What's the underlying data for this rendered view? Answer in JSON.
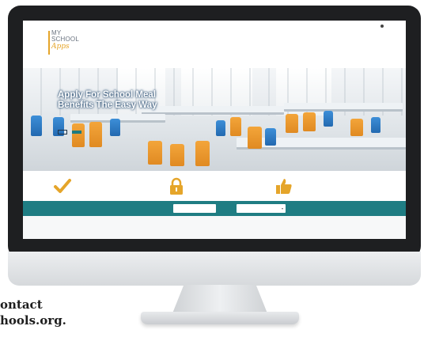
{
  "top_nav": {
    "items": [
      "",
      "",
      ""
    ]
  },
  "logo": {
    "line1": "MY",
    "line2": "SCHOOL",
    "line3": "Apps"
  },
  "hero": {
    "heading_line1": "Apply For School Meal",
    "heading_line2": "Benefits The Easy Way",
    "subtext": "",
    "learn_more_label": "",
    "apply_label": "",
    "tooltip": ""
  },
  "features": [
    {
      "title": "",
      "desc": ""
    },
    {
      "title": "",
      "desc": ""
    },
    {
      "title": "",
      "desc": ""
    }
  ],
  "search": {
    "label": "",
    "input1_placeholder": "",
    "input2_placeholder": "",
    "go_label": ""
  },
  "footer": {
    "copyright": "",
    "links": [
      "",
      ""
    ]
  },
  "side_text": {
    "line1": "ontact",
    "line2": "hools.org."
  },
  "colors": {
    "accent": "#e5a52a",
    "teal": "#1f7d83",
    "bezel": "#1e1f21"
  }
}
